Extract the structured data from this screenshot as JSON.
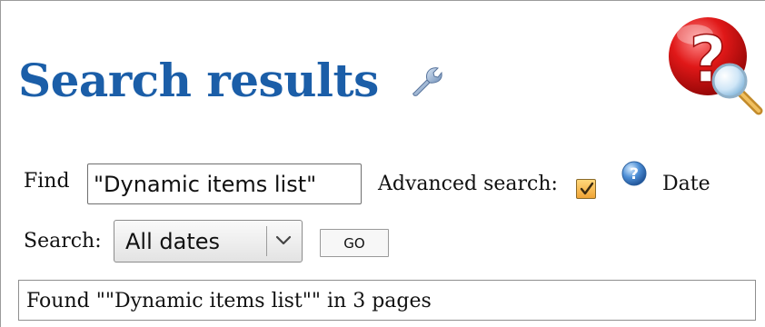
{
  "header": {
    "title": "Search results",
    "settings_icon": "wrench-icon",
    "logo_icon": "help-search-logo"
  },
  "form": {
    "find_label": "Find",
    "find_value": "\"Dynamic items list\"",
    "advanced_label": "Advanced search:",
    "advanced_checked": true,
    "help_icon": "help-icon",
    "date_label": "Date",
    "search_label": "Search:",
    "search_select": {
      "value": "All dates"
    },
    "go_label": "GO"
  },
  "result": {
    "text": "Found \"\"Dynamic items list\"\" in 3 pages"
  },
  "colors": {
    "title": "#1b5ea8",
    "checkbox": "#f0a436",
    "logo_red": "#d11414"
  }
}
